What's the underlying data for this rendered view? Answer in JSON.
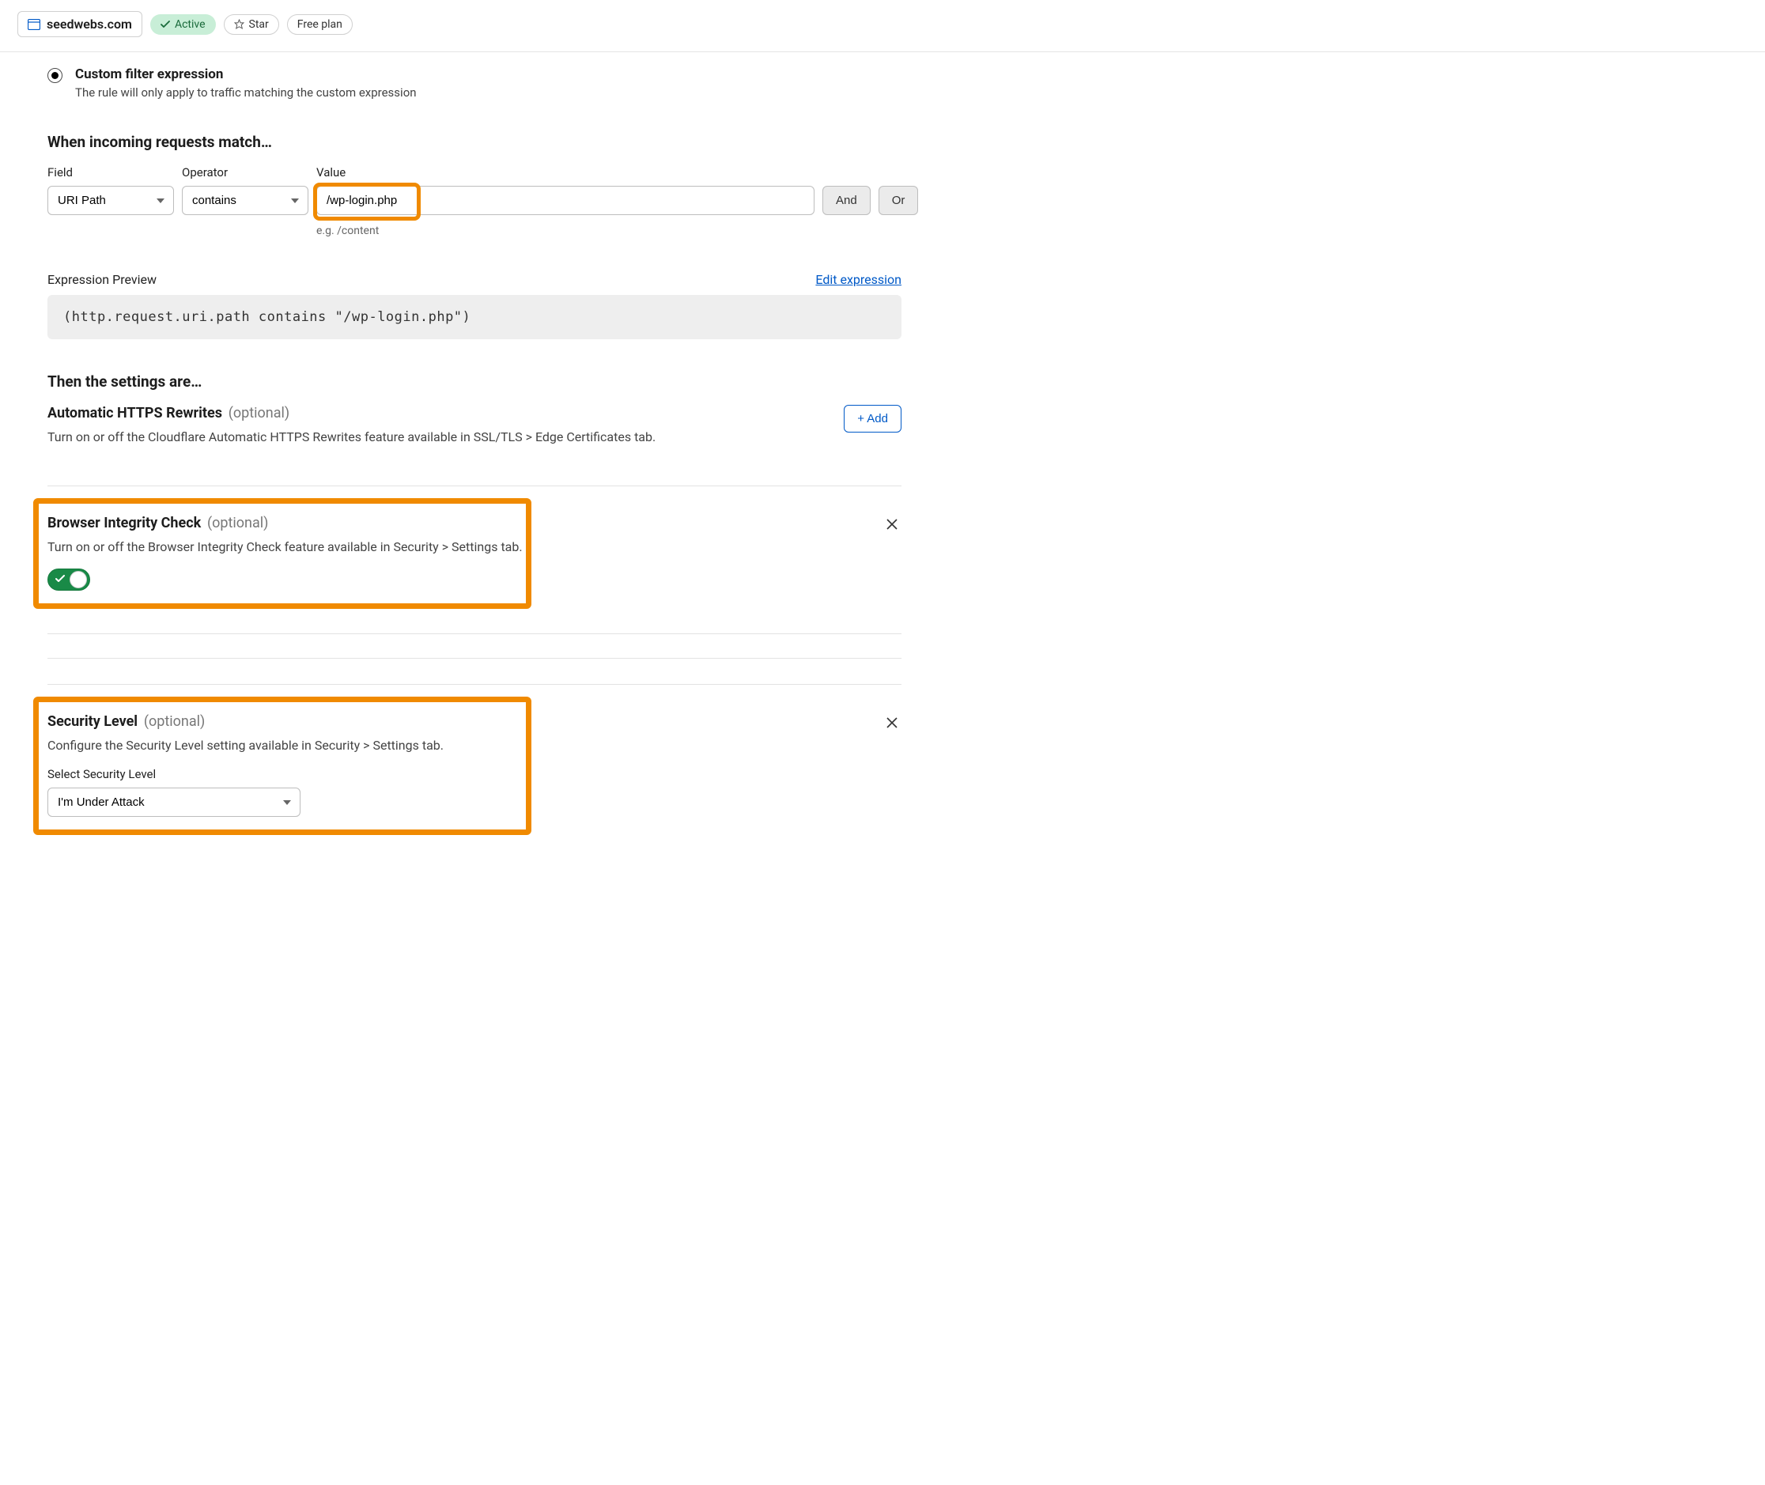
{
  "header": {
    "site": "seedwebs.com",
    "status": "Active",
    "star": "Star",
    "plan": "Free plan"
  },
  "radio": {
    "label": "Custom filter expression",
    "desc": "The rule will only apply to traffic matching the custom expression"
  },
  "match": {
    "heading": "When incoming requests match…",
    "field_label": "Field",
    "field_value": "URI Path",
    "operator_label": "Operator",
    "operator_value": "contains",
    "value_label": "Value",
    "value_value": "/wp-login.php",
    "value_hint": "e.g. /content",
    "and": "And",
    "or": "Or"
  },
  "preview": {
    "label": "Expression Preview",
    "edit": "Edit expression",
    "code": "(http.request.uri.path contains \"/wp-login.php\")"
  },
  "then": {
    "heading": "Then the settings are…"
  },
  "https": {
    "title": "Automatic HTTPS Rewrites",
    "optional": "(optional)",
    "desc": "Turn on or off the Cloudflare Automatic HTTPS Rewrites feature available in SSL/TLS > Edge Certificates tab.",
    "add": "+ Add"
  },
  "bic": {
    "title": "Browser Integrity Check",
    "optional": "(optional)",
    "desc": "Turn on or off the Browser Integrity Check feature available in Security > Settings tab."
  },
  "sec": {
    "title": "Security Level",
    "optional": "(optional)",
    "desc": "Configure the Security Level setting available in Security > Settings tab.",
    "select_label": "Select Security Level",
    "select_value": "I'm Under Attack"
  }
}
